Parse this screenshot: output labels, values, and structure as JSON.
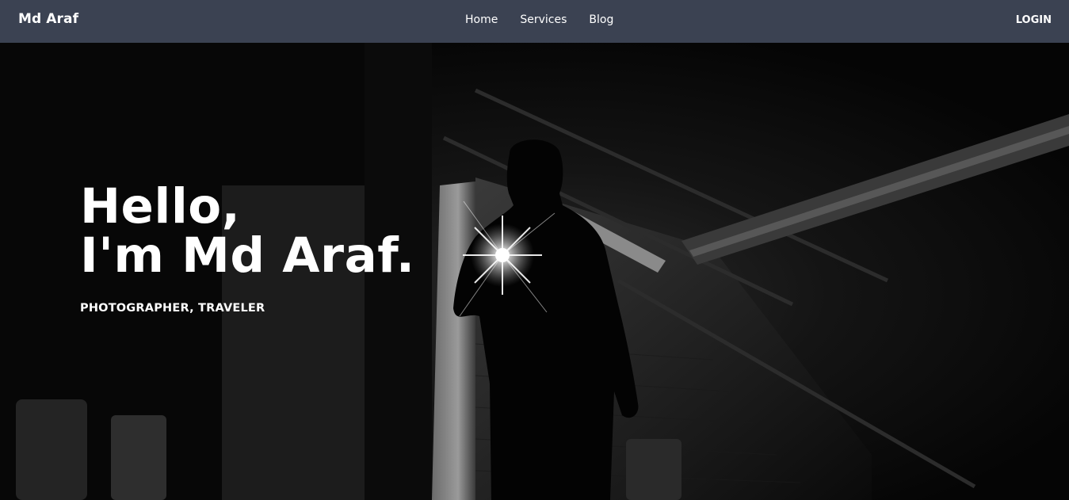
{
  "nav": {
    "brand": "Md Araf",
    "links": [
      "Home",
      "Services",
      "Blog"
    ],
    "login": "LOGIN"
  },
  "hero": {
    "greeting": "Hello,",
    "name_line": "I'm Md Araf.",
    "tagline": "PHOTOGRAPHER, TRAVELER"
  },
  "colors": {
    "navbar_bg": "#3b4252",
    "text": "#ffffff",
    "hero_bg": "#000000"
  }
}
